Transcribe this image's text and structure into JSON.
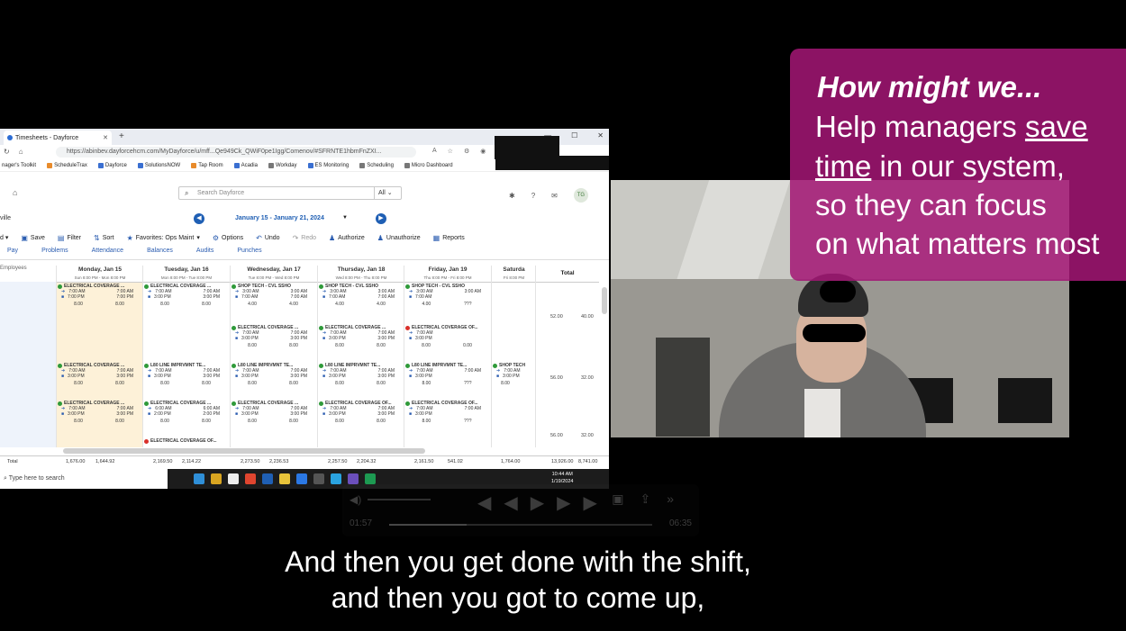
{
  "browser": {
    "tab_title": "Timesheets - Dayforce",
    "url": "https://abinbev.dayforcehcm.com/MyDayforce/u/mff...Qe949Ck_QWiF0pe1Igg/Comenov/#SFRNTE1hbmFnZXI...",
    "bookmarks": [
      "nager's Toolkit",
      "ScheduleTrax",
      "Dayforce",
      "SolutionsNOW",
      "Tap Room",
      "Acadia",
      "Workday",
      "ES Monitoring",
      "Scheduling",
      "Micro Dashboard"
    ]
  },
  "app": {
    "search_placeholder": "Search Dayforce",
    "search_scope": "All",
    "avatar_initials": "TG",
    "location": "ville",
    "date_range": "January 15 - January 21, 2024",
    "toolbar": [
      "Save",
      "Filter",
      "Sort",
      "Favorites: Ops Maint",
      "Options",
      "Undo",
      "Redo",
      "Authorize",
      "Unauthorize",
      "Reports"
    ],
    "subtabs": [
      "Pay",
      "Problems",
      "Attendance",
      "Balances",
      "Audits",
      "Punches"
    ],
    "employees_header": "Employees",
    "total_header": "Total",
    "days": [
      {
        "label": "Monday, Jan 15",
        "sub": "Sun 8:00 PM - Mon 8:00 PM"
      },
      {
        "label": "Tuesday, Jan 16",
        "sub": "Mon 8:00 PM - Tue 8:00 PM"
      },
      {
        "label": "Wednesday, Jan 17",
        "sub": "Tue 8:00 PM - Wed 8:00 PM"
      },
      {
        "label": "Thursday, Jan 18",
        "sub": "Wed 8:00 PM - Thu 8:00 PM"
      },
      {
        "label": "Friday, Jan 19",
        "sub": "Thu 8:00 PM - Fri 8:00 PM"
      },
      {
        "label": "Saturda",
        "sub": "Fri 8:00 PM"
      }
    ],
    "cells": [
      {
        "col": 0,
        "row": 0,
        "title": "ELECTRICAL COVERAGE ...",
        "a": "7:00 AM",
        "b": "7:00 AM",
        "c": "7:00 PM",
        "d": "7:00 PM",
        "t1": "8.00",
        "t2": "8.00"
      },
      {
        "col": 1,
        "row": 0,
        "title": "ELECTRICAL COVERAGE ...",
        "a": "7:00 AM",
        "b": "7:00 AM",
        "c": "3:00 PM",
        "d": "3:00 PM",
        "t1": "8.00",
        "t2": "8.00"
      },
      {
        "col": 2,
        "row": 0,
        "title": "SHOP TECH - CVL SSHO",
        "a": "3:00 AM",
        "b": "3:00 AM",
        "c": "7:00 AM",
        "d": "7:00 AM",
        "t1": "4.00",
        "t2": "4.00"
      },
      {
        "col": 3,
        "row": 0,
        "title": "SHOP TECH - CVL SSHO",
        "a": "3:00 AM",
        "b": "3:00 AM",
        "c": "7:00 AM",
        "d": "7:00 AM",
        "t1": "4.00",
        "t2": "4.00"
      },
      {
        "col": 4,
        "row": 0,
        "title": "SHOP TECH - CVL SSHO",
        "a": "3:00 AM",
        "b": "3:00 AM",
        "c": "7:00 AM",
        "d": "",
        "t1": "4.00",
        "t2": "???"
      },
      {
        "col": 2,
        "row": 1,
        "title": "ELECTRICAL COVERAGE ...",
        "a": "7:00 AM",
        "b": "7:00 AM",
        "c": "3:00 PM",
        "d": "3:00 PM",
        "t1": "8.00",
        "t2": "8.00"
      },
      {
        "col": 3,
        "row": 1,
        "title": "ELECTRICAL COVERAGE ...",
        "a": "7:00 AM",
        "b": "7:00 AM",
        "c": "3:00 PM",
        "d": "3:00 PM",
        "t1": "8.00",
        "t2": "8.00"
      },
      {
        "col": 4,
        "row": 1,
        "title": "ELECTRICAL COVERAGE OF...",
        "a": "7:00 AM",
        "b": "",
        "c": "3:00 PM",
        "d": "",
        "t1": "8.00",
        "t2": "0.00"
      },
      {
        "col": 0,
        "row": 2,
        "title": "ELECTRICAL COVERAGE ...",
        "a": "7:00 AM",
        "b": "7:00 AM",
        "c": "3:00 PM",
        "d": "3:00 PM",
        "t1": "8.00",
        "t2": "8.00"
      },
      {
        "col": 1,
        "row": 2,
        "title": "L80 LINE IMPRVMNT TE...",
        "a": "7:00 AM",
        "b": "7:00 AM",
        "c": "3:00 PM",
        "d": "3:00 PM",
        "t1": "8.00",
        "t2": "8.00"
      },
      {
        "col": 2,
        "row": 2,
        "title": "L80 LINE IMPRVMNT TE...",
        "a": "7:00 AM",
        "b": "7:00 AM",
        "c": "3:00 PM",
        "d": "3:00 PM",
        "t1": "8.00",
        "t2": "8.00"
      },
      {
        "col": 3,
        "row": 2,
        "title": "L80 LINE IMPRVMNT TE...",
        "a": "7:00 AM",
        "b": "7:00 AM",
        "c": "3:00 PM",
        "d": "3:00 PM",
        "t1": "8.00",
        "t2": "8.00"
      },
      {
        "col": 4,
        "row": 2,
        "title": "L80 LINE IMPRVMNT TE...",
        "a": "7:00 AM",
        "b": "7:00 AM",
        "c": "3:00 PM",
        "d": "",
        "t1": "8.00",
        "t2": "???"
      },
      {
        "col": 5,
        "row": 2,
        "title": "SHOP TECH",
        "a": "7:00 AM",
        "b": "",
        "c": "3:00 PM",
        "d": "",
        "t1": "8.00",
        "t2": ""
      },
      {
        "col": 0,
        "row": 3,
        "title": "ELECTRICAL COVERAGE ...",
        "a": "7:00 AM",
        "b": "7:00 AM",
        "c": "3:00 PM",
        "d": "3:00 PM",
        "t1": "8.00",
        "t2": "8.00"
      },
      {
        "col": 1,
        "row": 3,
        "title": "ELECTRICAL COVERAGE ...",
        "a": "6:00 AM",
        "b": "6:00 AM",
        "c": "2:00 PM",
        "d": "2:00 PM",
        "t1": "8.00",
        "t2": "8.00"
      },
      {
        "col": 2,
        "row": 3,
        "title": "ELECTRICAL COVERAGE ...",
        "a": "7:00 AM",
        "b": "7:00 AM",
        "c": "3:00 PM",
        "d": "3:00 PM",
        "t1": "8.00",
        "t2": "8.00"
      },
      {
        "col": 3,
        "row": 3,
        "title": "ELECTRICAL COVERAGE OF...",
        "a": "7:00 AM",
        "b": "7:00 AM",
        "c": "3:00 PM",
        "d": "3:00 PM",
        "t1": "8.00",
        "t2": "8.00"
      },
      {
        "col": 4,
        "row": 3,
        "title": "ELECTRICAL COVERAGE OF...",
        "a": "7:00 AM",
        "b": "7:00 AM",
        "c": "3:00 PM",
        "d": "",
        "t1": "8.00",
        "t2": "???"
      },
      {
        "col": 1,
        "row": 4,
        "title": "ELECTRICAL COVERAGE OF...",
        "a": "",
        "b": "",
        "c": "",
        "d": "",
        "t1": "",
        "t2": ""
      }
    ],
    "row_totals": [
      [
        "52.00",
        "40.00"
      ],
      [
        "56.00",
        "32.00"
      ],
      [
        "56.00",
        "32.00"
      ]
    ],
    "total_label": "Total",
    "totals": [
      "1,676.00",
      "1,644.92",
      "2,169.50",
      "2,114.22",
      "2,273.50",
      "2,236.53",
      "2,257.50",
      "2,204.32",
      "2,161.50",
      "541.02",
      "1,764.00",
      "13,926.00",
      "8,741.00"
    ]
  },
  "taskbar": {
    "search": "Type here to search",
    "time": "10:44 AM",
    "date": "1/19/2024"
  },
  "overlay": {
    "heading": "How might we...",
    "line1_pre": "Help managers ",
    "line1_u": "save",
    "line2_u": "time",
    "line2_post": " in our system,",
    "line3": "so they can focus",
    "line4": "on what matters most"
  },
  "player": {
    "elapsed": "01:57",
    "duration": "06:35",
    "progress": 0.296
  },
  "caption": {
    "line1": "And then you get done with the shift,",
    "line2": "and then you got to come up,"
  },
  "colors": {
    "overlay": "#a31675",
    "dayforce_blue": "#1f5fb4",
    "shift_green": "#2f9a3a",
    "shift_red": "#d9302a"
  }
}
